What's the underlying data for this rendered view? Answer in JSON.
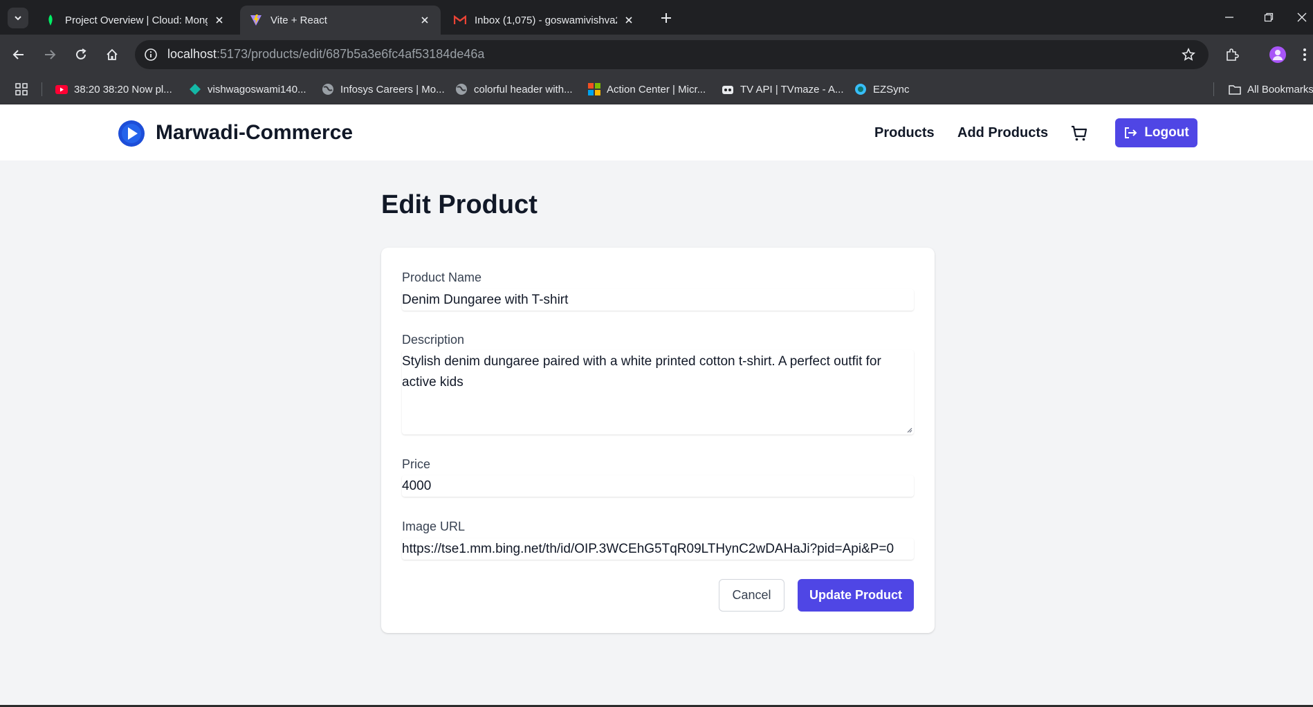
{
  "browser": {
    "tabs": [
      {
        "title": "Project Overview | Cloud: Mong",
        "icon": "mongodb-leaf-icon"
      },
      {
        "title": "Vite + React",
        "icon": "vite-icon",
        "active": true
      },
      {
        "title": "Inbox (1,075) - goswamivishva2",
        "icon": "gmail-icon"
      }
    ],
    "url_host": "localhost",
    "url_path": ":5173/products/edit/687b5a3e6fc4af53184de46a",
    "bookmarks": [
      {
        "label": "38:20 38:20 Now pl...",
        "icon": "youtube-icon"
      },
      {
        "label": "vishwagoswami140...",
        "icon": "diamond-icon"
      },
      {
        "label": "Infosys Careers | Mo...",
        "icon": "globe-icon"
      },
      {
        "label": "colorful header with...",
        "icon": "globe-icon"
      },
      {
        "label": "Action Center | Micr...",
        "icon": "microsoft-icon"
      },
      {
        "label": "TV API | TVmaze - A...",
        "icon": "tvmaze-icon"
      },
      {
        "label": "EZSync",
        "icon": "ezsync-icon"
      }
    ],
    "all_bookmarks": "All Bookmarks"
  },
  "navbar": {
    "brand": "Marwadi-Commerce",
    "links": [
      "Products",
      "Add Products"
    ],
    "logout": "Logout"
  },
  "page": {
    "title": "Edit Product"
  },
  "form": {
    "name_label": "Product Name",
    "name_value": "Denim Dungaree with T-shirt",
    "description_label": "Description",
    "description_value": "Stylish denim dungaree paired with a white printed cotton t-shirt. A perfect outfit for active kids",
    "price_label": "Price",
    "price_value": "4000",
    "image_label": "Image URL",
    "image_value": "https://tse1.mm.bing.net/th/id/OIP.3WCEhG5TqR09LTHynC2wDAHaJi?pid=Api&P=0",
    "cancel": "Cancel",
    "submit": "Update Product"
  },
  "colors": {
    "primary": "#4f46e5",
    "page_bg": "#f3f4f6",
    "chrome_dark": "#1f2023",
    "chrome_toolbar": "#35363a"
  }
}
